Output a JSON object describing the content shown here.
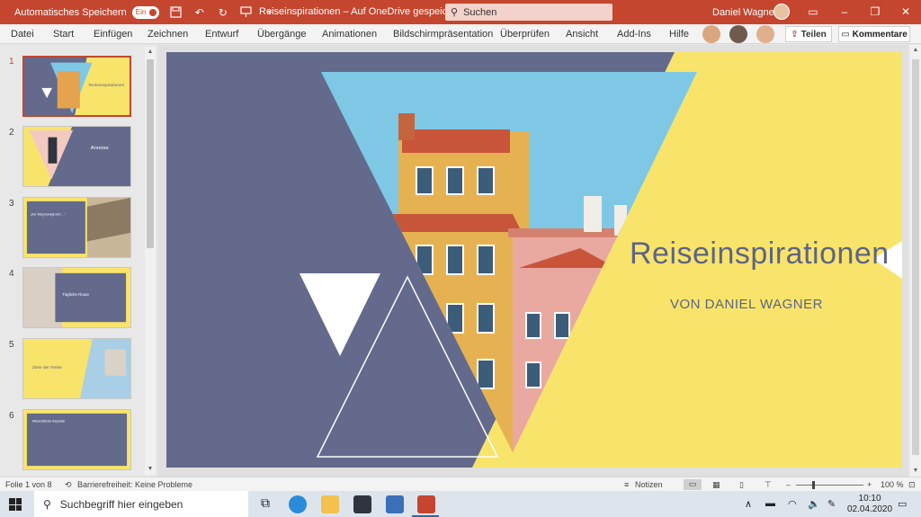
{
  "titlebar": {
    "autosave_label": "Automatisches Speichern",
    "autosave_state": "Ein",
    "document_title": "Reiseinspirationen – Auf OneDrive gespeichert",
    "search_label": "Suchen",
    "user_name": "Daniel Wagner"
  },
  "ribbon": {
    "tabs": [
      "Datei",
      "Start",
      "Einfügen",
      "Zeichnen",
      "Entwurf",
      "Übergänge",
      "Animationen",
      "Bildschirmpräsentation",
      "Überprüfen",
      "Ansicht",
      "Add-Ins",
      "Hilfe"
    ],
    "share_label": "Teilen",
    "comments_label": "Kommentare"
  },
  "thumbnails": {
    "numbers": [
      "1",
      "2",
      "3",
      "4",
      "5",
      "6"
    ],
    "slide1_title": "Reiseinspirationen",
    "slide2_title": "Anreise",
    "slide3_quote": "„Der Weg bewegt sich nicht durch unsere Schritte, sondern durch die Geschichten, die wir erzählen.“",
    "slide4_title": "Tägliche Route",
    "slide5_title": "Ziele der Reise",
    "slide6_title": "Wesentliche Aspekte"
  },
  "slide": {
    "title": "Reiseinspirationen",
    "subtitle": "VON DANIEL WAGNER"
  },
  "statusbar": {
    "slide_counter": "Folie 1 von 8",
    "accessibility": "Barrierefreiheit: Keine Probleme",
    "notes_label": "Notizen",
    "zoom": "100 %"
  },
  "taskbar": {
    "search_placeholder": "Suchbegriff hier eingeben",
    "time": "10:10",
    "date": "02.04.2020"
  },
  "colors": {
    "accent": "#c4462f",
    "slate": "#636a8c",
    "yellow": "#f9e46b",
    "sky": "#7ec8e6"
  }
}
